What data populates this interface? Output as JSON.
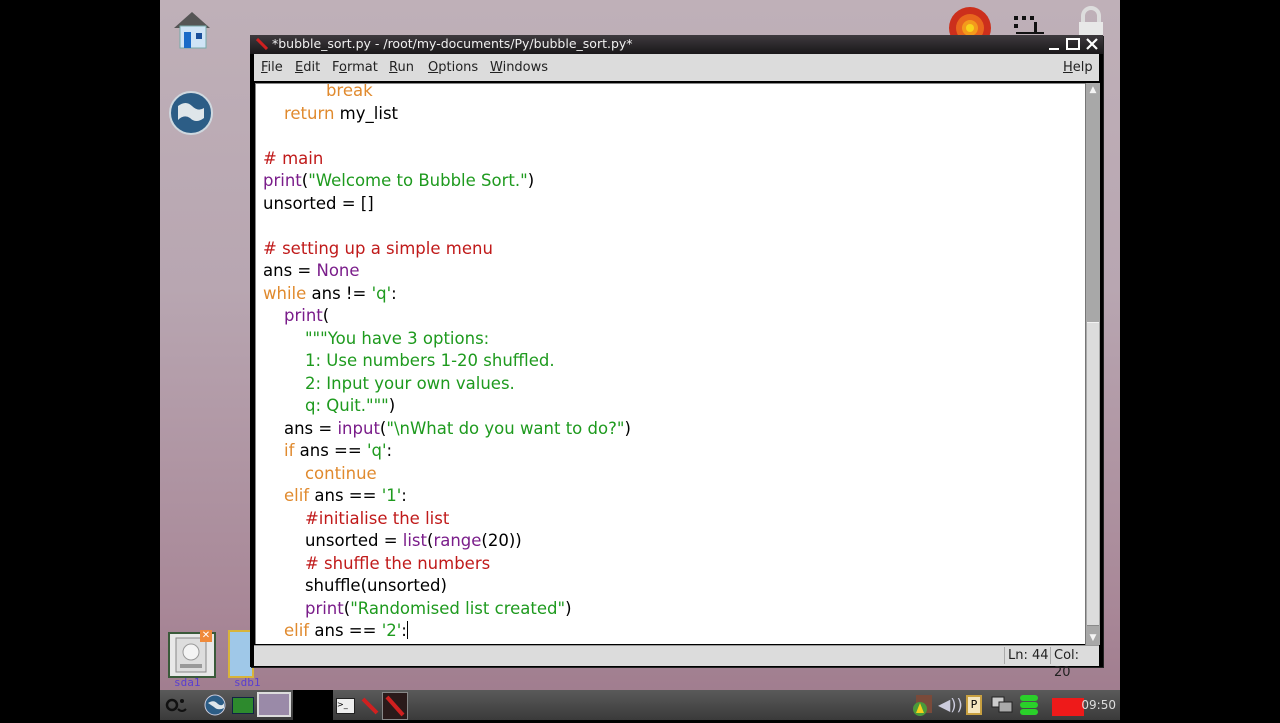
{
  "window": {
    "title": "*bubble_sort.py - /root/my-documents/Py/bubble_sort.py*",
    "controls": {
      "minimize": "_",
      "maximize": "□",
      "close": "✕"
    }
  },
  "menu": {
    "items": [
      {
        "key": "F",
        "rest": "ile"
      },
      {
        "key": "E",
        "rest": "dit"
      },
      {
        "pre": "F",
        "key": "o",
        "rest": "rmat"
      },
      {
        "key": "R",
        "rest": "un"
      },
      {
        "key": "O",
        "rest": "ptions"
      },
      {
        "key": "W",
        "rest": "indows"
      }
    ],
    "help": {
      "key": "H",
      "rest": "elp"
    }
  },
  "editor": {
    "lines": [
      [
        {
          "t": "            "
        },
        {
          "c": "kw",
          "t": "break"
        }
      ],
      [
        {
          "t": "    "
        },
        {
          "c": "kw",
          "t": "return"
        },
        {
          "t": " my_list"
        }
      ],
      [
        {
          "t": ""
        }
      ],
      [
        {
          "c": "cm",
          "t": "# main"
        }
      ],
      [
        {
          "c": "bi",
          "t": "print"
        },
        {
          "t": "("
        },
        {
          "c": "st",
          "t": "\"Welcome to Bubble Sort.\""
        },
        {
          "t": ")"
        }
      ],
      [
        {
          "t": "unsorted = []"
        }
      ],
      [
        {
          "t": ""
        }
      ],
      [
        {
          "c": "cm",
          "t": "# setting up a simple menu"
        }
      ],
      [
        {
          "t": "ans = "
        },
        {
          "c": "bi",
          "t": "None"
        }
      ],
      [
        {
          "c": "kw",
          "t": "while"
        },
        {
          "t": " ans != "
        },
        {
          "c": "st",
          "t": "'q'"
        },
        {
          "t": ":"
        }
      ],
      [
        {
          "t": "    "
        },
        {
          "c": "bi",
          "t": "print"
        },
        {
          "t": "("
        }
      ],
      [
        {
          "t": "        "
        },
        {
          "c": "st",
          "t": "\"\"\"You have 3 options:"
        }
      ],
      [
        {
          "t": "        "
        },
        {
          "c": "st",
          "t": "1: Use numbers 1-20 shuffled."
        }
      ],
      [
        {
          "t": "        "
        },
        {
          "c": "st",
          "t": "2: Input your own values."
        }
      ],
      [
        {
          "t": "        "
        },
        {
          "c": "st",
          "t": "q: Quit.\"\"\""
        },
        {
          "t": ")"
        }
      ],
      [
        {
          "t": "    ans = "
        },
        {
          "c": "bi",
          "t": "input"
        },
        {
          "t": "("
        },
        {
          "c": "st",
          "t": "\"\\nWhat do you want to do?\""
        },
        {
          "t": ")"
        }
      ],
      [
        {
          "t": "    "
        },
        {
          "c": "kw",
          "t": "if"
        },
        {
          "t": " ans == "
        },
        {
          "c": "st",
          "t": "'q'"
        },
        {
          "t": ":"
        }
      ],
      [
        {
          "t": "        "
        },
        {
          "c": "kw",
          "t": "continue"
        }
      ],
      [
        {
          "t": "    "
        },
        {
          "c": "kw",
          "t": "elif"
        },
        {
          "t": " ans == "
        },
        {
          "c": "st",
          "t": "'1'"
        },
        {
          "t": ":"
        }
      ],
      [
        {
          "t": "        "
        },
        {
          "c": "cm",
          "t": "#initialise the list"
        }
      ],
      [
        {
          "t": "        unsorted = "
        },
        {
          "c": "bi",
          "t": "list"
        },
        {
          "t": "("
        },
        {
          "c": "bi",
          "t": "range"
        },
        {
          "t": "(20))"
        }
      ],
      [
        {
          "t": "        "
        },
        {
          "c": "cm",
          "t": "# shuffle the numbers"
        }
      ],
      [
        {
          "t": "        shuffle(unsorted)"
        }
      ],
      [
        {
          "t": "        "
        },
        {
          "c": "bi",
          "t": "print"
        },
        {
          "t": "("
        },
        {
          "c": "st",
          "t": "\"Randomised list created\""
        },
        {
          "t": ")"
        }
      ],
      [
        {
          "t": "    "
        },
        {
          "c": "kw",
          "t": "elif"
        },
        {
          "t": " ans == "
        },
        {
          "c": "st",
          "t": "'2'"
        },
        {
          "t": ":"
        },
        {
          "cursor": true
        }
      ]
    ],
    "scroll_thumb_start_fraction": 0.42,
    "scroll_thumb_end_fraction": 0.98
  },
  "status": {
    "line": "Ln: 44",
    "col": "Col: 20"
  },
  "desktop": {
    "icons": [
      {
        "name": "home",
        "label": ""
      },
      {
        "name": "browser-globe",
        "label": ""
      },
      {
        "name": "drive-sda1",
        "label": "sda1"
      },
      {
        "name": "drive-sdb1",
        "label": "sdb1"
      }
    ]
  },
  "taskbar": {
    "clock": "09:50"
  },
  "colors": {
    "keyword": "#e08a2e",
    "comment": "#c01a1a",
    "string": "#1e9a1e",
    "builtin": "#7a1d8a"
  }
}
